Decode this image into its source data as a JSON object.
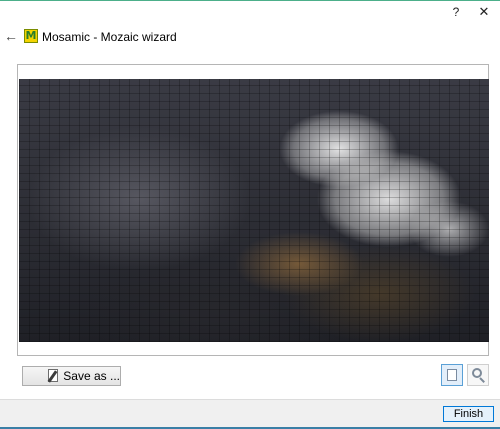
{
  "window": {
    "help_label": "?",
    "close_label": "✕",
    "back_label": "←"
  },
  "header": {
    "app_icon_letter": "M",
    "title": "Mosamic - Mozaic wizard"
  },
  "preview": {
    "image_description_icon": "mosaic-image"
  },
  "toolbar": {
    "save_as_label": "Save as ...",
    "fit_view_icon": "page-fit-icon",
    "zoom_icon": "magnifier-icon"
  },
  "footer": {
    "finish_label": "Finish"
  },
  "colors": {
    "accent": "#0078d7",
    "top_border": "#4caf8a",
    "app_icon_bg": "#f4d400",
    "app_icon_fg": "#2a7d2a"
  }
}
